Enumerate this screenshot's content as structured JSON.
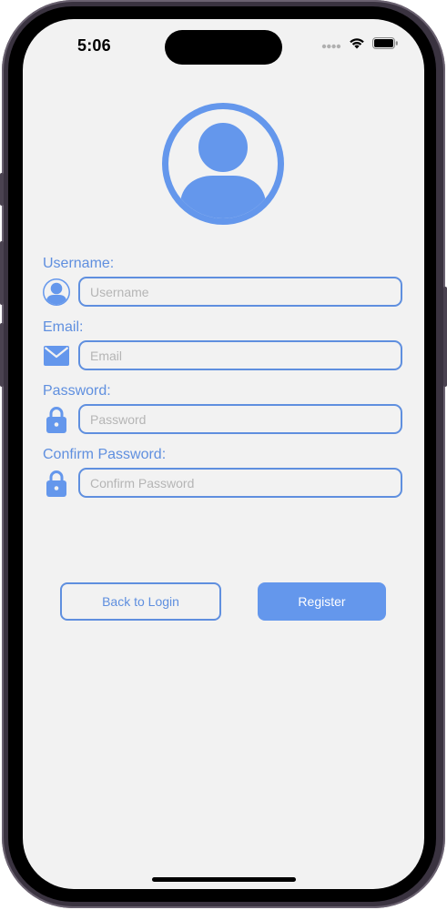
{
  "status_bar": {
    "time": "5:06"
  },
  "colors": {
    "accent": "#5f8fdf",
    "button_fill": "#6497ec",
    "background": "#f2f2f2"
  },
  "form": {
    "username": {
      "label": "Username:",
      "placeholder": "Username",
      "icon": "user-circle-icon"
    },
    "email": {
      "label": "Email:",
      "placeholder": "Email",
      "icon": "envelope-icon"
    },
    "password": {
      "label": "Password:",
      "placeholder": "Password",
      "icon": "lock-icon"
    },
    "confirm_password": {
      "label": "Confirm Password:",
      "placeholder": "Confirm Password",
      "icon": "lock-icon"
    }
  },
  "actions": {
    "back_label": "Back to Login",
    "register_label": "Register"
  }
}
